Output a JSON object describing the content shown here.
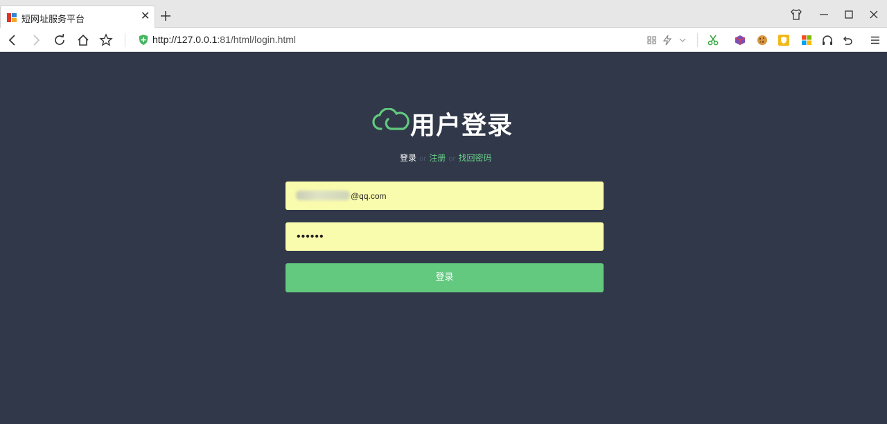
{
  "browser": {
    "tab_title": "短网址服务平台",
    "url_host": "http://127.0.0.1",
    "url_rest": ":81/html/login.html"
  },
  "page": {
    "title": "用户登录",
    "nav": {
      "login": "登录",
      "or1": "or",
      "register": "注册",
      "or2": "or",
      "forgot": "找回密码"
    },
    "email_value": "@qq.com",
    "password_value": "••••••",
    "submit_label": "登录"
  },
  "colors": {
    "background": "#303849",
    "accent": "#62c97e",
    "input_fill": "#fafcad"
  },
  "icons": [
    "back-icon",
    "forward-icon",
    "reload-icon",
    "home-icon",
    "star-icon",
    "shield-icon",
    "qr-icon",
    "lightning-icon",
    "chevron-down-icon",
    "scissors-icon",
    "cube-icon",
    "cookie-icon",
    "shield-badge-icon",
    "windows-icon",
    "headphones-icon",
    "undo-icon",
    "menu-icon",
    "cloud-logo-icon",
    "shirt-icon",
    "minimize-icon",
    "maximize-icon",
    "close-icon"
  ]
}
